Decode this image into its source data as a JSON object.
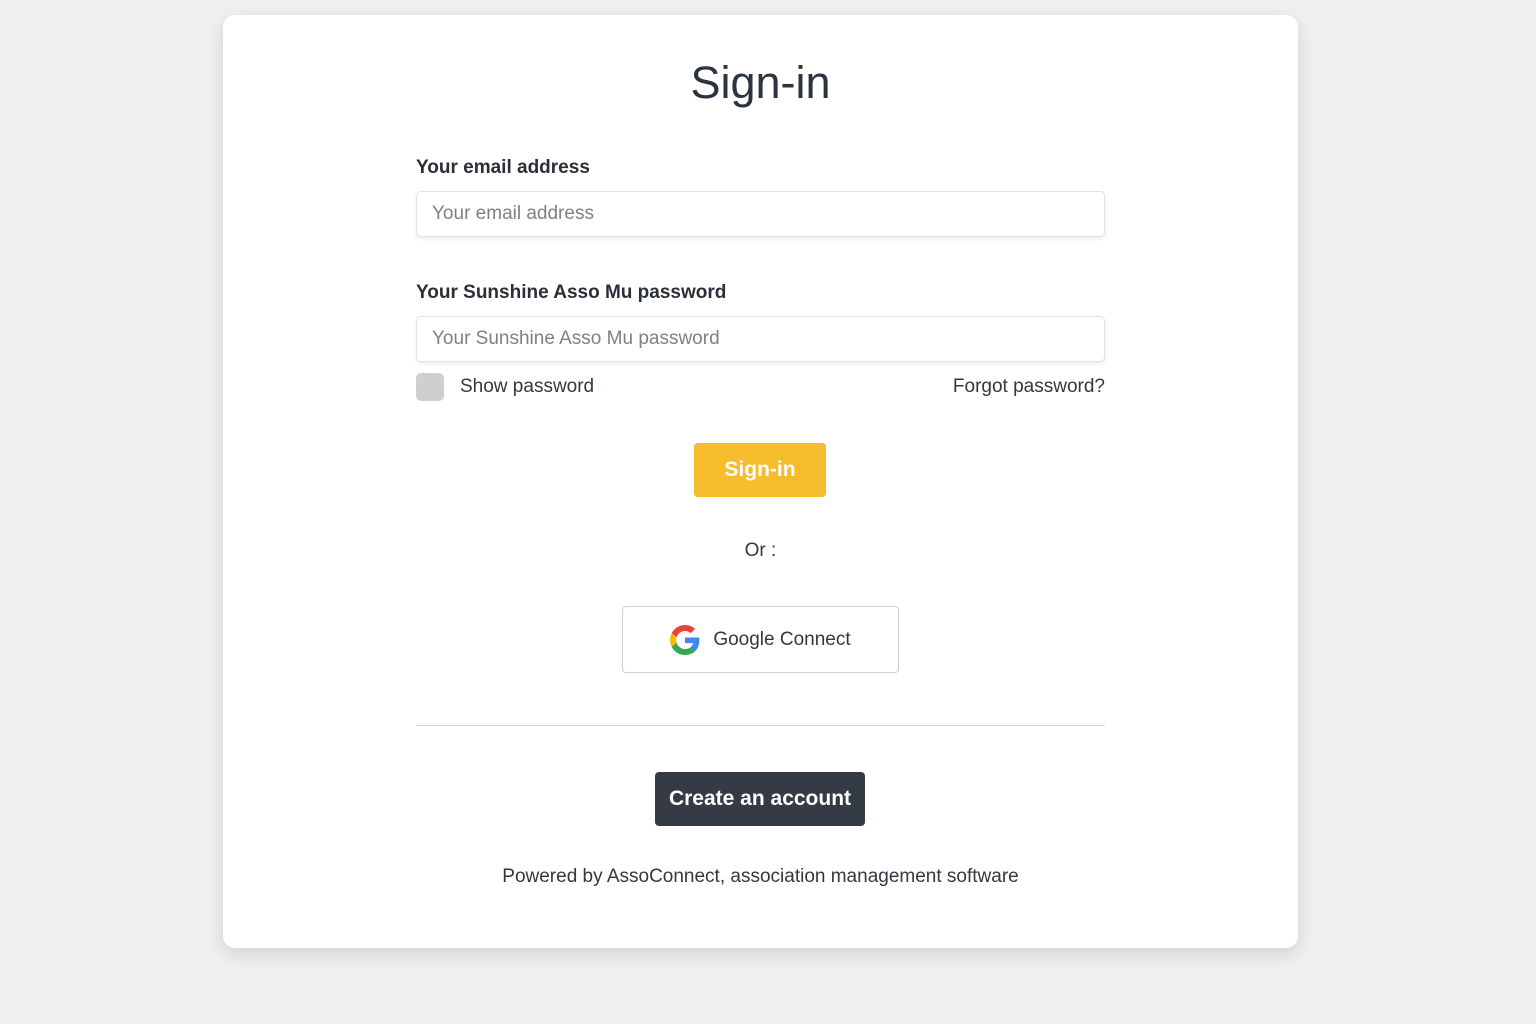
{
  "title": "Sign-in",
  "email": {
    "label": "Your email address",
    "placeholder": "Your email address",
    "value": ""
  },
  "password": {
    "label": "Your Sunshine Asso Mu password",
    "placeholder": "Your Sunshine Asso Mu password",
    "value": ""
  },
  "show_password": {
    "label": "Show password",
    "checked": false
  },
  "forgot_password": "Forgot password?",
  "signin_button": "Sign-in",
  "or_text": "Or :",
  "google_button": {
    "label": "Google Connect",
    "icon": "google-icon"
  },
  "create_account_button": "Create an account",
  "footer": "Powered by AssoConnect, association management software",
  "colors": {
    "background": "#efefef",
    "card": "#ffffff",
    "signin_accent": "#f5bc2c",
    "create_account": "#353b45",
    "text_dark": "#2c3340"
  }
}
